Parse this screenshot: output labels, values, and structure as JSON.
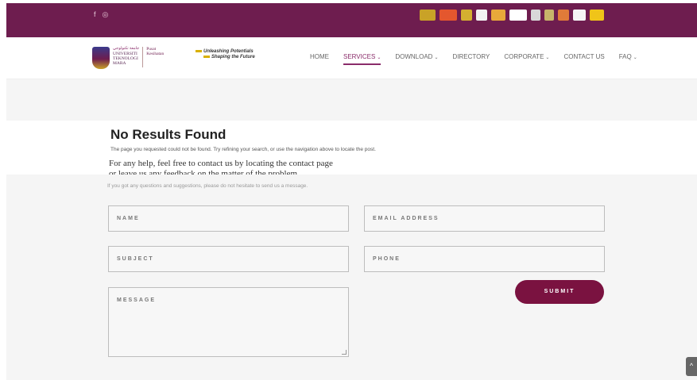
{
  "topbar": {
    "social": [
      {
        "name": "facebook-icon",
        "glyph": "f"
      },
      {
        "name": "instagram-icon",
        "glyph": "◎"
      }
    ],
    "partner_logos": [
      {
        "name": "partner-logo-1",
        "color": "#c9a227"
      },
      {
        "name": "partner-logo-the",
        "color": "#e4572e"
      },
      {
        "name": "partner-logo-3",
        "color": "#d4b030"
      },
      {
        "name": "partner-logo-4",
        "color": "#f2f2f2"
      },
      {
        "name": "partner-logo-5",
        "color": "#e8a93a"
      },
      {
        "name": "partner-logo-6",
        "color": "#ffffff"
      },
      {
        "name": "partner-logo-7",
        "color": "#d8d8d8"
      },
      {
        "name": "partner-logo-8",
        "color": "#c7b46a"
      },
      {
        "name": "partner-logo-9",
        "color": "#e07b39"
      },
      {
        "name": "partner-logo-10",
        "color": "#f5f5f5"
      },
      {
        "name": "partner-logo-11",
        "color": "#f0c419"
      }
    ]
  },
  "header": {
    "brand": {
      "arabic": "ﺟﺎﻣﻌﺔ ﺗﻜﻨﻮﻟﻮﺟﻲ",
      "line1": "UNIVERSITI",
      "line2": "TEKNOLOGI",
      "line3": "MARA",
      "sub1": "Pusat",
      "sub2": "Kesihatan"
    },
    "tagline": {
      "line1": "Unleashing Potentials",
      "line2": "Shaping the Future"
    },
    "nav": [
      {
        "label": "HOME",
        "dropdown": false,
        "active": false
      },
      {
        "label": "SERVICES",
        "dropdown": true,
        "active": true
      },
      {
        "label": "DOWNLOAD",
        "dropdown": true,
        "active": false
      },
      {
        "label": "DIRECTORY",
        "dropdown": false,
        "active": false
      },
      {
        "label": "CORPORATE",
        "dropdown": true,
        "active": false
      },
      {
        "label": "CONTACT US",
        "dropdown": false,
        "active": false
      },
      {
        "label": "FAQ",
        "dropdown": true,
        "active": false
      }
    ]
  },
  "content": {
    "title": "No Results Found",
    "description": "The page you requested could not be found. Try refining your search, or use the navigation above to locate the post.",
    "help_line1": "For any help, feel free to contact us by locating the contact page",
    "help_line2": "or leave us any feedback on the matter of the problem."
  },
  "form": {
    "intro": "If you got any questions and suggestions, please do not hesitate to send us a message.",
    "name_placeholder": "NAME",
    "email_placeholder": "EMAIL ADDRESS",
    "subject_placeholder": "SUBJECT",
    "phone_placeholder": "PHONE",
    "message_placeholder": "MESSAGE",
    "submit_label": "SUBMIT"
  },
  "colors": {
    "brand": "#6e1d4f",
    "button": "#7a1240",
    "active_nav": "#8a2c6a"
  }
}
